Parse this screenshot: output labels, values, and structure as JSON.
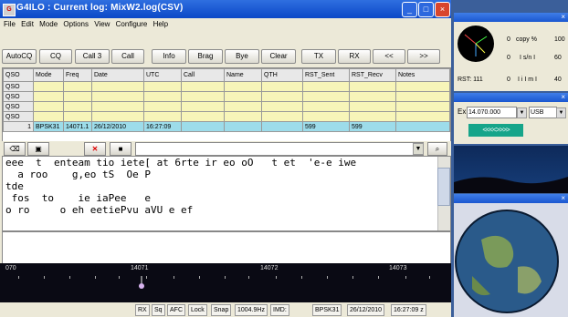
{
  "window": {
    "title": "G4ILO : Current log: MixW2.log(CSV)",
    "logo_text": "G"
  },
  "menu": [
    "File",
    "Edit",
    "Mode",
    "Options",
    "View",
    "Configure",
    "Help"
  ],
  "toolbar": [
    "AutoCQ",
    "CQ",
    "Call 3",
    "Call",
    "Info",
    "Brag",
    "Bye",
    "Clear",
    "TX",
    "RX",
    "<<",
    ">>"
  ],
  "log": {
    "columns": [
      "QSO",
      "Mode",
      "Freq",
      "Date",
      "UTC",
      "Call",
      "Name",
      "QTH",
      "RST_Sent",
      "RST_Recv",
      "Notes"
    ],
    "empty_rows": [
      "QSO",
      "QSO",
      "QSO",
      "QSO"
    ],
    "active_row": {
      "num": "1",
      "mode": "BPSK31",
      "freq": "14071.1",
      "date": "26/12/2010",
      "utc": "16:27:09",
      "call": "",
      "name": "",
      "qth": "",
      "rst_sent": "599",
      "rst_recv": "599",
      "notes": ""
    }
  },
  "rx_lines": [
    "eee  t  enteam tio iete[ at 6rte ir eo oO   t et  'e-e iwe",
    "  a roo    g,eo tS  Oe P",
    "tde",
    " fos  to    ie iaPee   e",
    "o ro     o eh eetiePvu aVU e ef"
  ],
  "waterfall": {
    "labels": [
      "070",
      "14071",
      "14072",
      "14073"
    ]
  },
  "status": {
    "items": [
      "RX",
      "Sq",
      "AFC",
      "Lock",
      "Snap",
      "1004.9Hz",
      "IMD:",
      "BPSK31",
      "26/12/2010",
      "16:27:09 z"
    ]
  },
  "right": {
    "copy_label": "copy %",
    "copy_val": "100",
    "zero1": "0",
    "zero2": "0",
    "sm_label": "I s/n I",
    "sm_val": "60",
    "rst_label": "RST: 111",
    "rst_zero": "0",
    "scale_label": "I i I m I",
    "scale_val": "40",
    "ex_label": "Ex",
    "freq": "14.070.000",
    "mode": "USB",
    "tune": "<<<<>>>>"
  }
}
